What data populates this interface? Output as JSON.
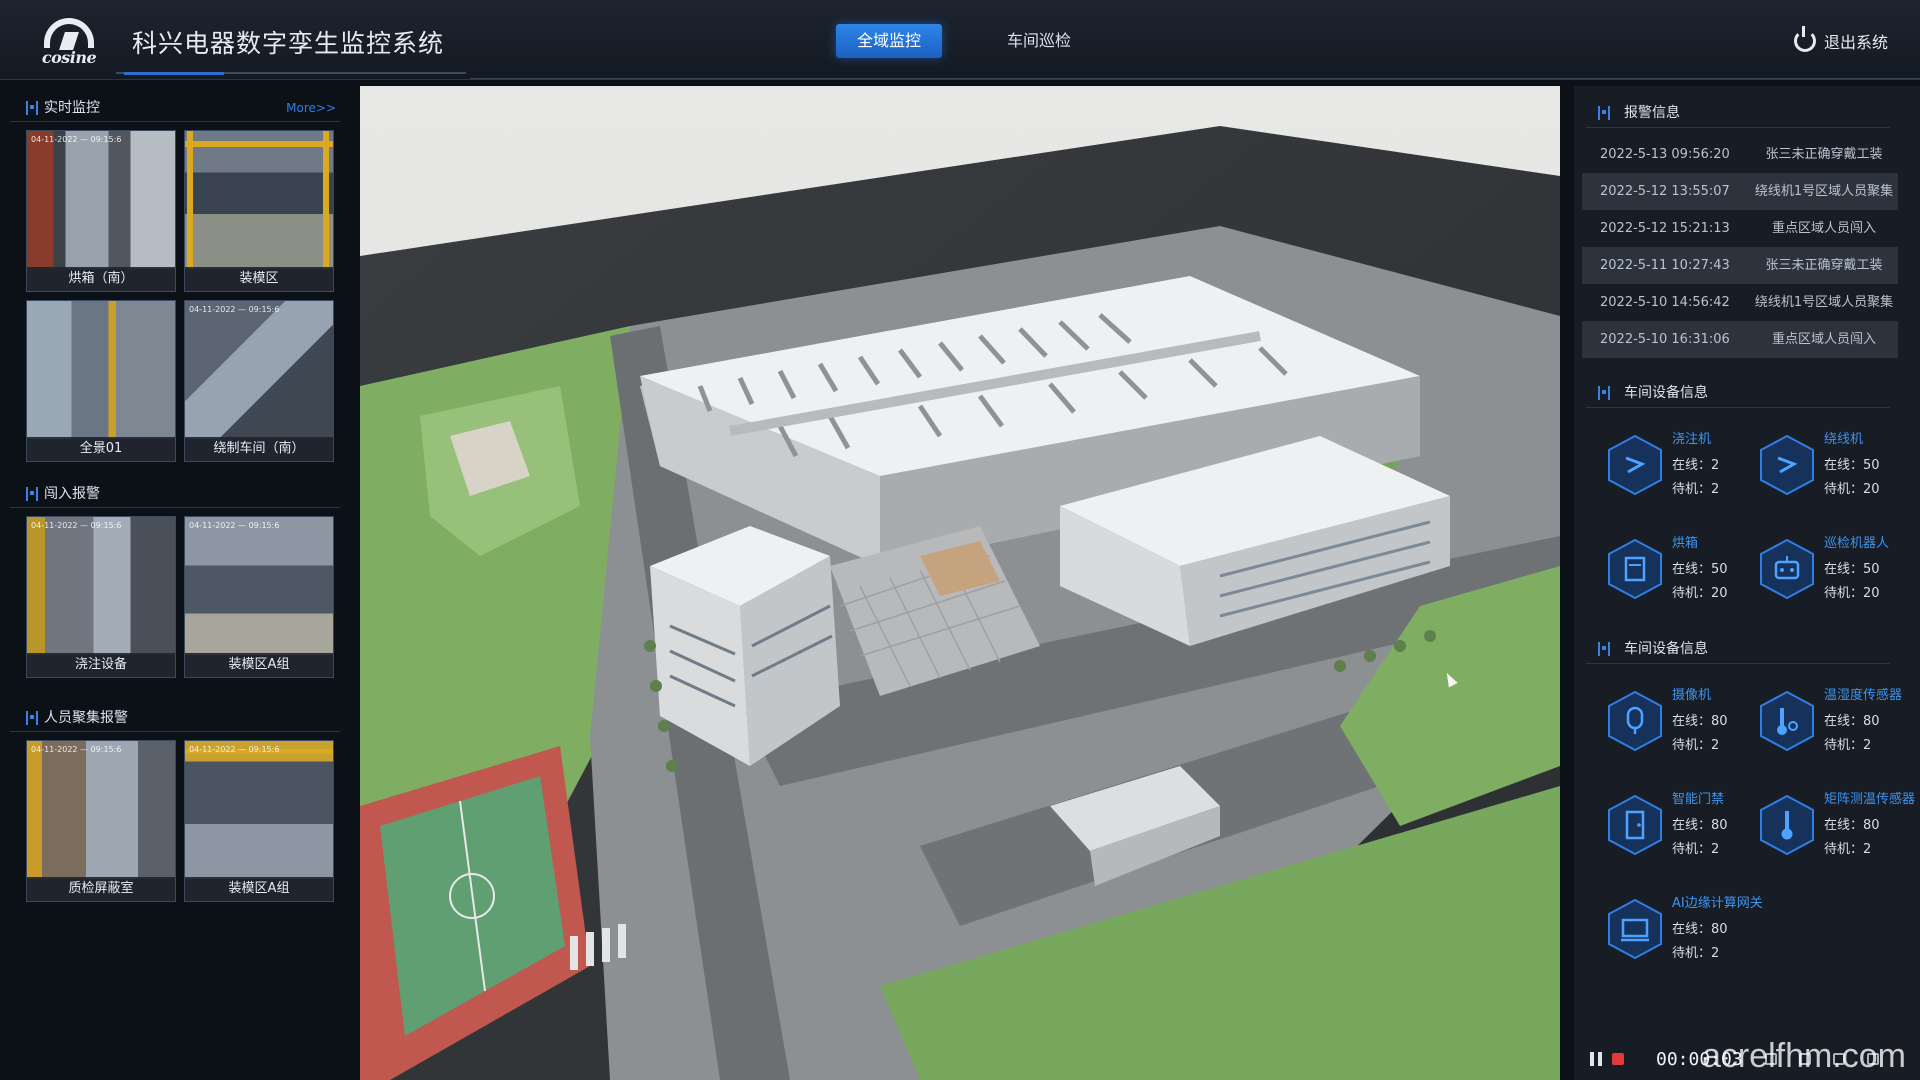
{
  "header": {
    "logo_text": "cosine",
    "title": "科兴电器数字孪生监控系统",
    "tabs": [
      {
        "label": "全域监控",
        "active": true
      },
      {
        "label": "车间巡检",
        "active": false
      }
    ],
    "logout_label": "退出系统",
    "accent_color": "#2a7de1"
  },
  "left": {
    "realtime": {
      "title": "实时监控",
      "more": "More>>",
      "cams": [
        {
          "label": "烘箱（南）",
          "ts": "04-11-2022 — 09:15:6"
        },
        {
          "label": "装模区",
          "ts": ""
        },
        {
          "label": "全景01",
          "ts": ""
        },
        {
          "label": "绕制车间（南）",
          "ts": "04-11-2022 — 09:15:6"
        }
      ]
    },
    "intrusion": {
      "title": "闯入报警",
      "cams": [
        {
          "label": "浇注设备",
          "ts": "04-11-2022 — 09:15:6"
        },
        {
          "label": "装模区A组",
          "ts": "04-11-2022 — 09:15:6"
        }
      ]
    },
    "crowd": {
      "title": "人员聚集报警",
      "cams": [
        {
          "label": "质检屏蔽室",
          "ts": "04-11-2022 — 09:15:6"
        },
        {
          "label": "装模区A组",
          "ts": "04-11-2022 — 09:15:6"
        }
      ]
    }
  },
  "alarms": {
    "title": "报警信息",
    "rows": [
      {
        "time": "2022-5-13 09:56:20",
        "msg": "张三未正确穿戴工装"
      },
      {
        "time": "2022-5-12 13:55:07",
        "msg": "绕线机1号区域人员聚集"
      },
      {
        "time": "2022-5-12 15:21:13",
        "msg": "重点区域人员闯入"
      },
      {
        "time": "2022-5-11 10:27:43",
        "msg": "张三未正确穿戴工装"
      },
      {
        "time": "2022-5-10 14:56:42",
        "msg": "绕线机1号区域人员聚集"
      },
      {
        "time": "2022-5-10 16:31:06",
        "msg": "重点区域人员闯入"
      }
    ]
  },
  "devices1": {
    "title": "车间设备信息",
    "items": [
      {
        "name": "浇注机",
        "online": "在线：2",
        "standby": "待机：2",
        "icon": "pour-machine-icon"
      },
      {
        "name": "绕线机",
        "online": "在线：50",
        "standby": "待机：20",
        "icon": "winding-machine-icon"
      },
      {
        "name": "烘箱",
        "online": "在线：50",
        "standby": "待机：20",
        "icon": "oven-icon"
      },
      {
        "name": "巡检机器人",
        "online": "在线：50",
        "standby": "待机：20",
        "icon": "robot-icon"
      }
    ]
  },
  "devices2": {
    "title": "车间设备信息",
    "items": [
      {
        "name": "摄像机",
        "online": "在线：80",
        "standby": "待机：2",
        "icon": "camera-icon"
      },
      {
        "name": "温湿度传感器",
        "online": "在线：80",
        "standby": "待机：2",
        "icon": "thermo-hygro-icon"
      },
      {
        "name": "智能门禁",
        "online": "在线：80",
        "standby": "待机：2",
        "icon": "door-access-icon"
      },
      {
        "name": "矩阵测温传感器",
        "online": "在线：80",
        "standby": "待机：2",
        "icon": "matrix-temp-icon"
      },
      {
        "name": "AI边缘计算网关",
        "online": "在线：80",
        "standby": "待机：2",
        "icon": "ai-gateway-icon"
      }
    ]
  },
  "player": {
    "timer": "00:00:03",
    "watermark": "acrelfhm.com"
  }
}
